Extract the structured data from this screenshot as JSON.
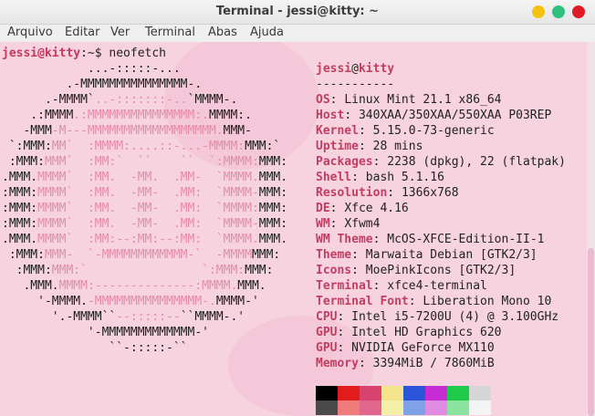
{
  "window": {
    "title": "Terminal - jessi@kitty: ~",
    "buttons": {
      "minimize_color": "#f5c211",
      "maximize_color": "#2ec27e",
      "close_color": "#e01b24"
    }
  },
  "menu": [
    "Arquivo",
    "Editar",
    "Ver",
    "Terminal",
    "Abas",
    "Ajuda"
  ],
  "prompt": {
    "user_host": "jessi@kitty",
    "rest": ":~$ neofetch"
  },
  "ascii_art": [
    [
      [
        "            ...-:::::-...",
        "dark"
      ]
    ],
    [
      [
        "         .-MMMMMMMMMMMMMMM-.",
        "dark"
      ]
    ],
    [
      [
        "      .-MMMM`",
        "dark"
      ],
      [
        "..-:::::::-..",
        "pink"
      ],
      [
        "`MMMM-.",
        "dark"
      ]
    ],
    [
      [
        "    .:MMMM",
        "dark"
      ],
      [
        ".:MMMMMMMMMMMMMMM:.",
        "pink"
      ],
      [
        "MMMM:.",
        "dark"
      ]
    ],
    [
      [
        "   -MMM",
        "dark"
      ],
      [
        "-M---MMMMMMMMMMMMMMMMMM.",
        "pink"
      ],
      [
        "MMM-",
        "dark"
      ]
    ],
    [
      [
        " `:MMM:",
        "dark"
      ],
      [
        "MM`  :MMMM:....::-...-MMMM:",
        "pink"
      ],
      [
        "MMM:`",
        "dark"
      ]
    ],
    [
      [
        " :MMM:",
        "dark"
      ],
      [
        "MMM`  :MM:`  ``    ``  `:MMMM:",
        "pink"
      ],
      [
        "MMM:",
        "dark"
      ]
    ],
    [
      [
        ".MMM.",
        "dark"
      ],
      [
        "MMMM`  :MM.  -MM.  .MM-  `MMMM.",
        "pink"
      ],
      [
        "MMM.",
        "dark"
      ]
    ],
    [
      [
        ":MMM:",
        "dark"
      ],
      [
        "MMMM`  :MM.  -MM-  .MM:  `MMMM-",
        "pink"
      ],
      [
        "MMM:",
        "dark"
      ]
    ],
    [
      [
        ":MMM:",
        "dark"
      ],
      [
        "MMMM`  :MM.  -MM-  .MM:  `MMMM:",
        "pink"
      ],
      [
        "MMM:",
        "dark"
      ]
    ],
    [
      [
        ":MMM:",
        "dark"
      ],
      [
        "MMMM`  :MM.  -MM-  .MM:  `MMMM-",
        "pink"
      ],
      [
        "MMM:",
        "dark"
      ]
    ],
    [
      [
        ".MMM.",
        "dark"
      ],
      [
        "MMMM`  :MM:--:MM:--:MM:  `MMMM.",
        "pink"
      ],
      [
        "MMM.",
        "dark"
      ]
    ],
    [
      [
        " :MMM:",
        "dark"
      ],
      [
        "MMM-  `-MMMMMMMMMMMM-`  -MMMM",
        "pink"
      ],
      [
        "MMM:",
        "dark"
      ]
    ],
    [
      [
        "  :MMM:",
        "dark"
      ],
      [
        "MMM:`                `:MMM:",
        "pink"
      ],
      [
        "MMM:",
        "dark"
      ]
    ],
    [
      [
        "   .MMM.",
        "dark"
      ],
      [
        "MMMM:--------------:MMMM.",
        "pink"
      ],
      [
        "MMM.",
        "dark"
      ]
    ],
    [
      [
        "     '-MMMM.",
        "dark"
      ],
      [
        "-MMMMMMMMMMMMMMM-.",
        "pink"
      ],
      [
        "MMMM-'",
        "dark"
      ]
    ],
    [
      [
        "       '.-MMMM``",
        "dark"
      ],
      [
        "--:::::--",
        "pink"
      ],
      [
        "``MMMM-.'",
        "dark"
      ]
    ],
    [
      [
        "            '-MMMMMMMMMMMMM-'",
        "dark"
      ]
    ],
    [
      [
        "               ``-:::::-``",
        "dark"
      ]
    ]
  ],
  "info": {
    "user": "jessi",
    "at": "@",
    "host": "kitty",
    "separator": "-----------",
    "rows": [
      {
        "key": "OS",
        "value": "Linux Mint 21.1 x86_64"
      },
      {
        "key": "Host",
        "value": "340XAA/350XAA/550XAA P03REP"
      },
      {
        "key": "Kernel",
        "value": "5.15.0-73-generic"
      },
      {
        "key": "Uptime",
        "value": "28 mins"
      },
      {
        "key": "Packages",
        "value": "2238 (dpkg), 22 (flatpak)"
      },
      {
        "key": "Shell",
        "value": "bash 5.1.16"
      },
      {
        "key": "Resolution",
        "value": "1366x768"
      },
      {
        "key": "DE",
        "value": "Xfce 4.16"
      },
      {
        "key": "WM",
        "value": "Xfwm4"
      },
      {
        "key": "WM Theme",
        "value": "McOS-XFCE-Edition-II-1"
      },
      {
        "key": "Theme",
        "value": "Marwaita Debian [GTK2/3]"
      },
      {
        "key": "Icons",
        "value": "MoePinkIcons [GTK2/3]"
      },
      {
        "key": "Terminal",
        "value": "xfce4-terminal"
      },
      {
        "key": "Terminal Font",
        "value": "Liberation Mono 10"
      },
      {
        "key": "CPU",
        "value": "Intel i5-7200U (4) @ 3.100GHz"
      },
      {
        "key": "GPU",
        "value": "Intel HD Graphics 620"
      },
      {
        "key": "GPU",
        "value": "NVIDIA GeForce MX110"
      },
      {
        "key": "Memory",
        "value": "3394MiB / 7860MiB"
      }
    ]
  },
  "palette": {
    "row1": [
      "#000000",
      "#e21b1b",
      "#d9426e",
      "#f4e28c",
      "#2a55d8",
      "#c72bd4",
      "#1fc94a",
      "#d6d6d6"
    ],
    "row2": [
      "#4a4a4a",
      "#f07b7b",
      "#e0668d",
      "#f5f0a8",
      "#7ea1e8",
      "#e08ce0",
      "#8be3a0",
      "#f4f4f4"
    ]
  },
  "colors": {
    "background": "#f7d3df",
    "key": "#c23d62",
    "art_pink": "#e48ca7"
  }
}
